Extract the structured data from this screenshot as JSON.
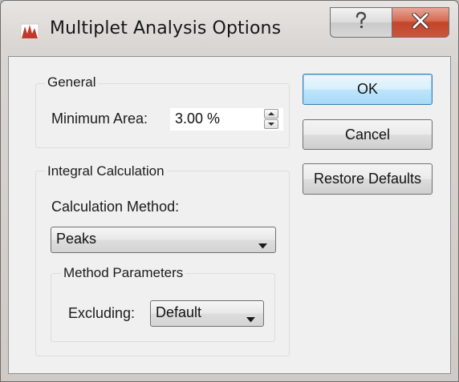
{
  "window": {
    "title": "Multiplet Analysis Options",
    "app_icon": "mnova-app-icon",
    "help_icon": "question-mark-icon",
    "close_icon": "close-x-icon"
  },
  "general": {
    "group_label": "General",
    "min_area_label": "Minimum Area:",
    "min_area_value": "3.00 %"
  },
  "integral": {
    "group_label": "Integral Calculation",
    "method_label": "Calculation Method:",
    "method_value": "Peaks",
    "params": {
      "group_label": "Method Parameters",
      "excluding_label": "Excluding:",
      "excluding_value": "Default"
    }
  },
  "buttons": {
    "ok": "OK",
    "cancel": "Cancel",
    "restore": "Restore Defaults"
  },
  "colors": {
    "close_button": "#c7563c",
    "default_button_border": "#3c7fb1"
  }
}
